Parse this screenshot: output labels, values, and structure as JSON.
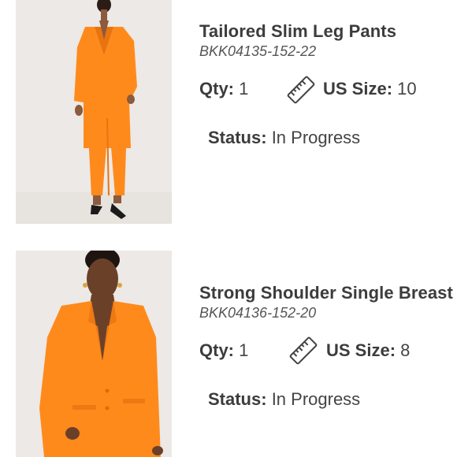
{
  "items": [
    {
      "name": "Tailored Slim Leg Pants",
      "sku": "BKK04135-152-22",
      "qty_label": "Qty:",
      "qty_value": "1",
      "size_label": "US Size:",
      "size_value": "10",
      "status_label": "Status:",
      "status_value": "In Progress",
      "image_description": "full-length model in orange suit",
      "size_icon": "ruler-icon"
    },
    {
      "name": "Strong Shoulder Single Breast",
      "sku": "BKK04136-152-20",
      "qty_label": "Qty:",
      "qty_value": "1",
      "size_label": "US Size:",
      "size_value": "8",
      "status_label": "Status:",
      "status_value": "In Progress",
      "image_description": "close-up model in orange blazer",
      "size_icon": "ruler-icon"
    }
  ],
  "colors": {
    "product_orange": "#ff8a1c",
    "text": "#3c3c3c",
    "photo_background": "#ece9e6"
  }
}
